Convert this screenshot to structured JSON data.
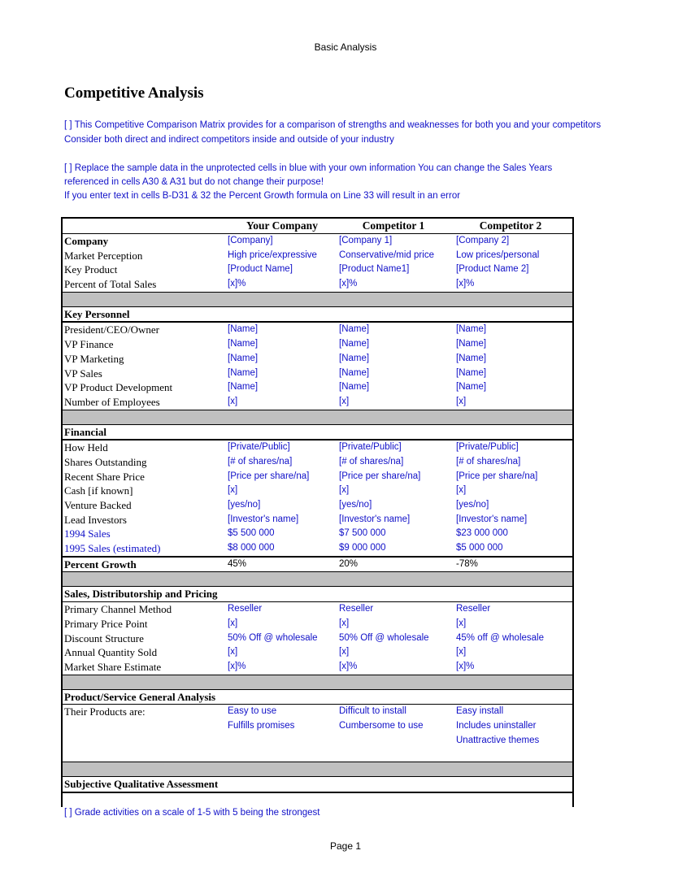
{
  "page_header": "Basic Analysis",
  "page_footer": "Page 1",
  "title": "Competitive Analysis",
  "notes": [
    "[ ]  This Competitive Comparison Matrix provides for a comparison of strengths and weaknesses for both you and your competitors",
    "Consider both direct and indirect competitors  inside and outside of your industry",
    "[ ]  Replace the sample data in the unprotected cells in blue with your own information   You can change the Sales Years",
    "referenced in cells A30 & A31  but do not change their purpose!",
    "If you enter text in cells B-D31 & 32  the Percent Growth formula on Line 33 will result in an error"
  ],
  "columns": [
    "Your Company",
    "Competitor 1",
    "Competitor 2"
  ],
  "company": {
    "label": "Company",
    "values": [
      "[Company]",
      "[Company 1]",
      "[Company 2]"
    ],
    "rows": [
      {
        "label": "Market Perception",
        "values": [
          "High price/expressive",
          "Conservative/mid price",
          "Low prices/personal"
        ]
      },
      {
        "label": "Key Product",
        "values": [
          "[Product Name]",
          "[Product Name1]",
          "[Product Name 2]"
        ]
      },
      {
        "label": "Percent of Total Sales",
        "values": [
          "[x]%",
          "[x]%",
          "[x]%"
        ]
      }
    ]
  },
  "key_personnel": {
    "label": "Key Personnel",
    "rows": [
      {
        "label": "President/CEO/Owner",
        "values": [
          "[Name]",
          "[Name]",
          "[Name]"
        ]
      },
      {
        "label": "VP Finance",
        "values": [
          "[Name]",
          "[Name]",
          "[Name]"
        ]
      },
      {
        "label": "VP Marketing",
        "values": [
          "[Name]",
          "[Name]",
          "[Name]"
        ]
      },
      {
        "label": "VP Sales",
        "values": [
          "[Name]",
          "[Name]",
          "[Name]"
        ]
      },
      {
        "label": "VP Product Development",
        "values": [
          "[Name]",
          "[Name]",
          "[Name]"
        ]
      },
      {
        "label": "Number of Employees",
        "values": [
          "[x]",
          "[x]",
          "[x]"
        ]
      }
    ]
  },
  "financial": {
    "label": "Financial",
    "rows": [
      {
        "label": "How Held",
        "values": [
          "[Private/Public]",
          "[Private/Public]",
          "[Private/Public]"
        ]
      },
      {
        "label": "Shares Outstanding",
        "values": [
          "[# of shares/na]",
          "[# of shares/na]",
          "[# of shares/na]"
        ]
      },
      {
        "label": "Recent Share Price",
        "values": [
          "[Price per share/na]",
          "[Price per share/na]",
          "[Price per share/na]"
        ]
      },
      {
        "label": "Cash [if known]",
        "values": [
          "[x]",
          "[x]",
          "[x]"
        ]
      },
      {
        "label": "Venture Backed",
        "values": [
          "[yes/no]",
          "[yes/no]",
          "[yes/no]"
        ]
      },
      {
        "label": "Lead Investors",
        "values": [
          "[Investor's name]",
          "[Investor's name]",
          "[Investor's name]"
        ]
      },
      {
        "label": "1994 Sales",
        "values": [
          "$5 500 000",
          "$7 500 000",
          "$23 000 000"
        ]
      },
      {
        "label": "1995 Sales (estimated)",
        "values": [
          "$8 000 000",
          "$9 000 000",
          "$5 000 000"
        ]
      }
    ],
    "growth": {
      "label": "Percent Growth",
      "values": [
        "45%",
        "20%",
        "-78%"
      ]
    }
  },
  "sales": {
    "label": "Sales, Distributorship and Pricing",
    "rows": [
      {
        "label": "Primary Channel Method",
        "values": [
          "Reseller",
          "Reseller",
          "Reseller"
        ]
      },
      {
        "label": "Primary Price Point",
        "values": [
          "[x]",
          "[x]",
          "[x]"
        ]
      },
      {
        "label": "Discount Structure",
        "values": [
          "50% Off @ wholesale",
          "50% Off @ wholesale",
          "45% off @ wholesale"
        ]
      },
      {
        "label": "Annual Quantity Sold",
        "values": [
          "[x]",
          "[x]",
          "[x]"
        ]
      },
      {
        "label": "Market Share Estimate",
        "values": [
          "[x]%",
          "[x]%",
          "[x]%"
        ]
      }
    ]
  },
  "product": {
    "label": "Product/Service General Analysis",
    "row_label": "Their Products are:",
    "lines": [
      [
        "Easy to use",
        "Difficult to install",
        "Easy install"
      ],
      [
        "Fulfills promises",
        "Cumbersome to use",
        "Includes uninstaller"
      ],
      [
        "",
        "",
        "Unattractive themes"
      ]
    ]
  },
  "subjective": {
    "label": "Subjective Qualitative Assessment",
    "note": "[ ]  Grade activities on a scale of 1-5  with 5 being the strongest"
  }
}
